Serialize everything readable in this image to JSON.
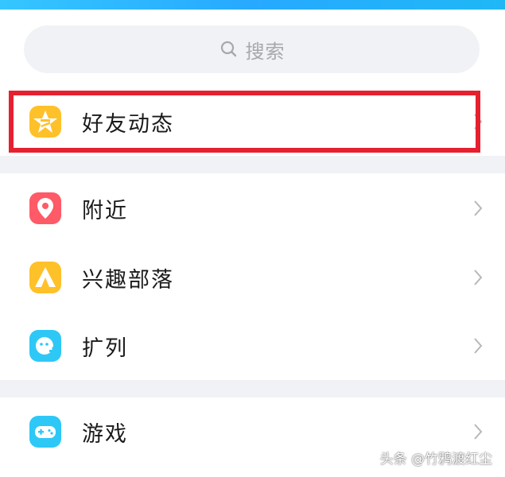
{
  "search": {
    "placeholder": "搜索"
  },
  "sections": [
    {
      "items": [
        {
          "label": "好友动态",
          "icon": "star-icon",
          "color": "#ffc12a"
        }
      ]
    },
    {
      "items": [
        {
          "label": "附近",
          "icon": "location-pin-icon",
          "color": "#ff5a67"
        },
        {
          "label": "兴趣部落",
          "icon": "tent-icon",
          "color": "#ffc12a"
        },
        {
          "label": "扩列",
          "icon": "add-friend-icon",
          "color": "#2ec8f6"
        }
      ]
    },
    {
      "items": [
        {
          "label": "游戏",
          "icon": "gamepad-icon",
          "color": "#2ec8f6"
        }
      ]
    }
  ],
  "highlight_color": "#e6202f",
  "watermark": "头条 @竹鸦渡红尘"
}
